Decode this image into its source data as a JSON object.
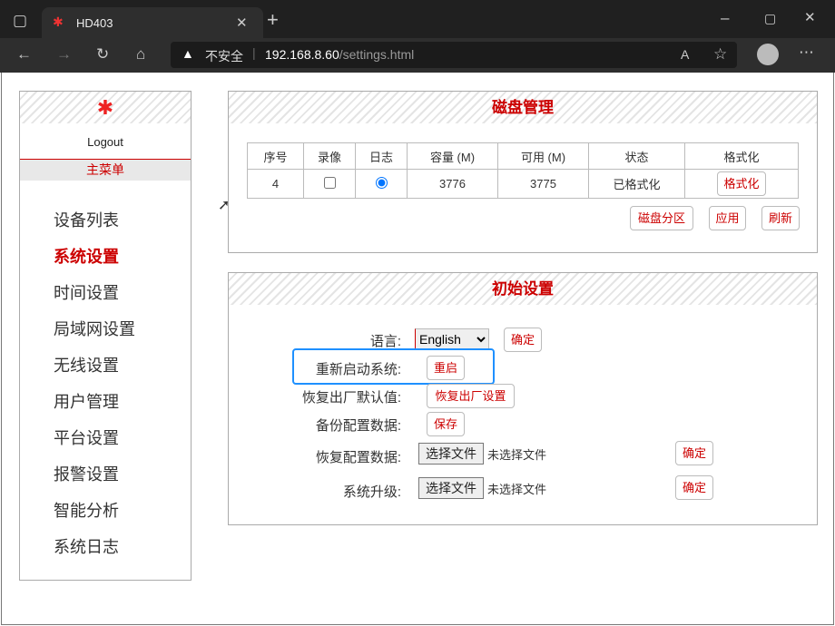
{
  "browser": {
    "tab_title": "HD403",
    "security_label": "不安全",
    "url_host": "192.168.8.60",
    "url_path": "/settings.html"
  },
  "sidebar": {
    "logout": "Logout",
    "menu_header": "主菜单",
    "items": [
      {
        "label": "设备列表"
      },
      {
        "label": "系统设置",
        "active": true
      },
      {
        "label": "时间设置"
      },
      {
        "label": "局域网设置"
      },
      {
        "label": "无线设置"
      },
      {
        "label": "用户管理"
      },
      {
        "label": "平台设置"
      },
      {
        "label": "报警设置"
      },
      {
        "label": "智能分析"
      },
      {
        "label": "系统日志"
      }
    ]
  },
  "disk": {
    "title": "磁盘管理",
    "headers": [
      "序号",
      "录像",
      "日志",
      "容量 (M)",
      "可用 (M)",
      "状态",
      "格式化"
    ],
    "rows": [
      {
        "index": "4",
        "record": false,
        "log": true,
        "capacity": "3776",
        "available": "3775",
        "status": "已格式化",
        "format_button": "格式化"
      }
    ],
    "buttons": {
      "partition": "磁盘分区",
      "apply": "应用",
      "refresh": "刷新"
    }
  },
  "init": {
    "title": "初始设置",
    "language_label": "语言:",
    "language_value": "English",
    "confirm": "确定",
    "reboot_label": "重新启动系统:",
    "reboot_button": "重启",
    "factory_label": "恢复出厂默认值:",
    "factory_button": "恢复出厂设置",
    "backup_label": "备份配置数据:",
    "backup_button": "保存",
    "restore_label": "恢复配置数据:",
    "upgrade_label": "系统升级:",
    "choose_file": "选择文件",
    "no_file": "未选择文件"
  },
  "colors": {
    "accent": "#cc0000",
    "highlight": "#1e90ff"
  }
}
